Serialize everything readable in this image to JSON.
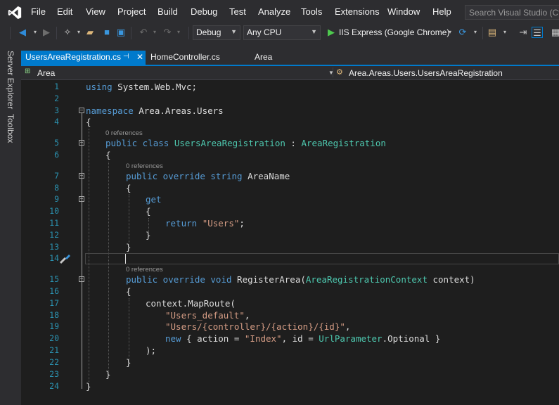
{
  "menu": [
    "File",
    "Edit",
    "View",
    "Project",
    "Build",
    "Debug",
    "Test",
    "Analyze",
    "Tools",
    "Extensions",
    "Window",
    "Help"
  ],
  "search_placeholder": "Search Visual Studio (Ctrl",
  "toolbar": {
    "config": "Debug",
    "platform": "Any CPU",
    "run_target": "IIS Express (Google Chrome)"
  },
  "side_tabs": [
    "Server Explorer",
    "Toolbox"
  ],
  "tabs": [
    {
      "label": "UsersAreaRegistration.cs",
      "pin": "⊣",
      "close": "✕"
    },
    {
      "label": "HomeController.cs"
    },
    {
      "label": "Area"
    }
  ],
  "navbar": {
    "project": "Area",
    "member": "Area.Areas.Users.UsersAreaRegistration"
  },
  "code": {
    "line_numbers": [
      "1",
      "2",
      "3",
      "4",
      "5",
      "6",
      "7",
      "8",
      "9",
      "10",
      "11",
      "12",
      "13",
      "14",
      "15",
      "16",
      "17",
      "18",
      "19",
      "20",
      "21",
      "22",
      "23",
      "24"
    ],
    "references_label": "0 references",
    "l1_kw": "using",
    "l1_rest": " System.Web.Mvc;",
    "l3_kw": "namespace",
    "l3_rest": " Area.Areas.Users",
    "brace_open": "{",
    "brace_close": "}",
    "l5_kw": "public class",
    "l5_type": "UsersAreaRegistration",
    "l5_colon": " : ",
    "l5_base": "AreaRegistration",
    "l7_kw": "public override string",
    "l7_name": " AreaName",
    "l9_kw": "get",
    "l11_kw": "return",
    "l11_str": "\"Users\"",
    "semicolon": ";",
    "l15_kw": "public override void",
    "l15_name": " RegisterArea(",
    "l15_type": "AreaRegistrationContext",
    "l15_rest": " context)",
    "l17_text": "context.MapRoute(",
    "l18_str": "\"Users_default\"",
    "comma": ",",
    "l19_str": "\"Users/{controller}/{action}/{id}\"",
    "l20_kw": "new",
    "l20_mid": " { action = ",
    "l20_str": "\"Index\"",
    "l20_id": ", id = ",
    "l20_type": "UrlParameter",
    "l20_end": ".Optional }",
    "l21_text": ");"
  }
}
